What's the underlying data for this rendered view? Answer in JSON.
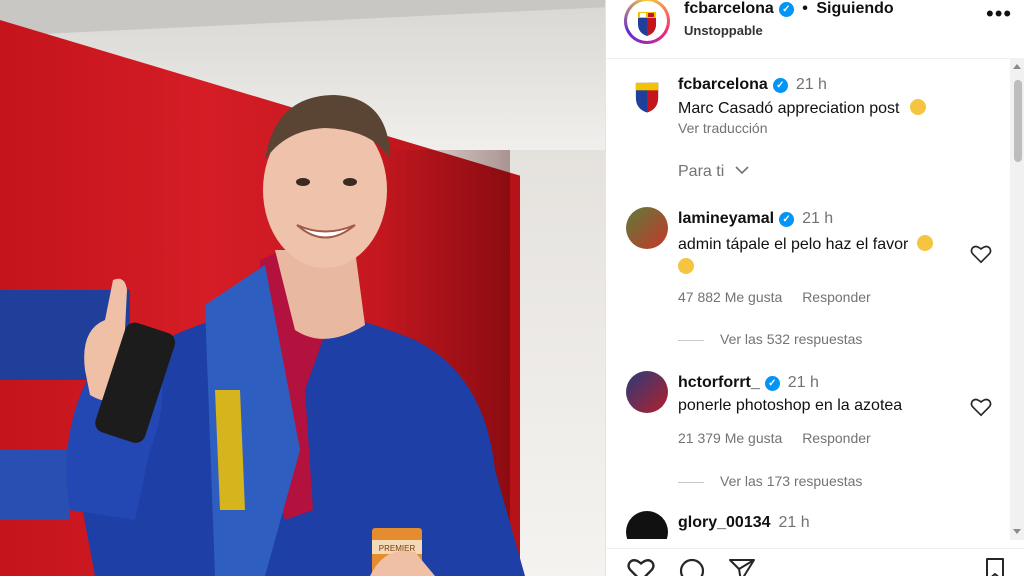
{
  "header": {
    "username": "fcbarcelona",
    "separator": "•",
    "follow_status": "Siguiendo",
    "subtitle": "Unstoppable",
    "more": "•••"
  },
  "caption": {
    "username": "fcbarcelona",
    "time": "21 h",
    "text": "Marc Casadó appreciation post",
    "translate": "Ver traducción"
  },
  "sort": {
    "label": "Para ti"
  },
  "comments": [
    {
      "username": "lamineyamal",
      "time": "21 h",
      "text": "admin tápale el pelo haz el favor",
      "likes": "47 882 Me gusta",
      "reply": "Responder",
      "view_replies": "Ver las 532 respuestas"
    },
    {
      "username": "hctorforrt_",
      "time": "21 h",
      "text": "ponerle photoshop en la azotea",
      "likes": "21 379 Me gusta",
      "reply": "Responder",
      "view_replies": "Ver las 173 respuestas"
    },
    {
      "username": "glory_00134",
      "time": "21 h"
    }
  ],
  "photo": {
    "cup_text": "PREMIER"
  },
  "colors": {
    "verified": "#0095f6",
    "barca_blue": "#1f3f9a",
    "barca_red": "#c4141c"
  }
}
